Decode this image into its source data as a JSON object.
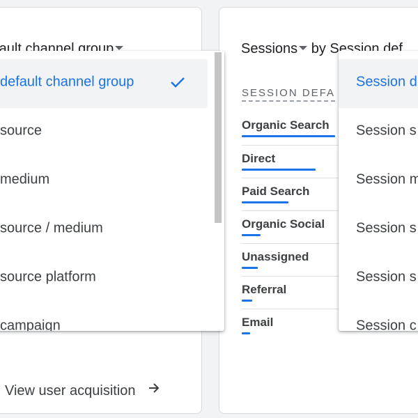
{
  "left_card": {
    "title": "efault channel group",
    "footer_link": "View user acquisition",
    "footer_icon": "arrow-right-icon"
  },
  "right_card": {
    "title_metric": "Sessions",
    "title_rest": " by Session def",
    "column_header": "SESSION DEFA",
    "rows": [
      {
        "label": "Organic Search",
        "bar_fraction": 1.0
      },
      {
        "label": "Direct",
        "bar_fraction": 0.79
      },
      {
        "label": "Paid Search",
        "bar_fraction": 0.5
      },
      {
        "label": "Organic Social",
        "bar_fraction": 0.2
      },
      {
        "label": "Unassigned",
        "bar_fraction": 0.17
      },
      {
        "label": "Referral",
        "bar_fraction": 0.11
      },
      {
        "label": "Email",
        "bar_fraction": 0.09
      }
    ]
  },
  "dropdown_left": {
    "items": [
      {
        "label": "default channel group",
        "selected": true
      },
      {
        "label": "source",
        "selected": false
      },
      {
        "label": "medium",
        "selected": false
      },
      {
        "label": "source / medium",
        "selected": false
      },
      {
        "label": "source platform",
        "selected": false
      },
      {
        "label": "campaign",
        "selected": false
      }
    ],
    "selected_icon": "check-icon"
  },
  "dropdown_right": {
    "items": [
      {
        "label": "Session d",
        "selected": true
      },
      {
        "label": "Session s",
        "selected": false
      },
      {
        "label": "Session m",
        "selected": false
      },
      {
        "label": "Session s",
        "selected": false
      },
      {
        "label": "Session s",
        "selected": false
      },
      {
        "label": "Session c",
        "selected": false
      }
    ]
  },
  "colors": {
    "accent": "#1a73e8",
    "text": "#3c4043",
    "selected_bg": "#f1f3f4"
  }
}
